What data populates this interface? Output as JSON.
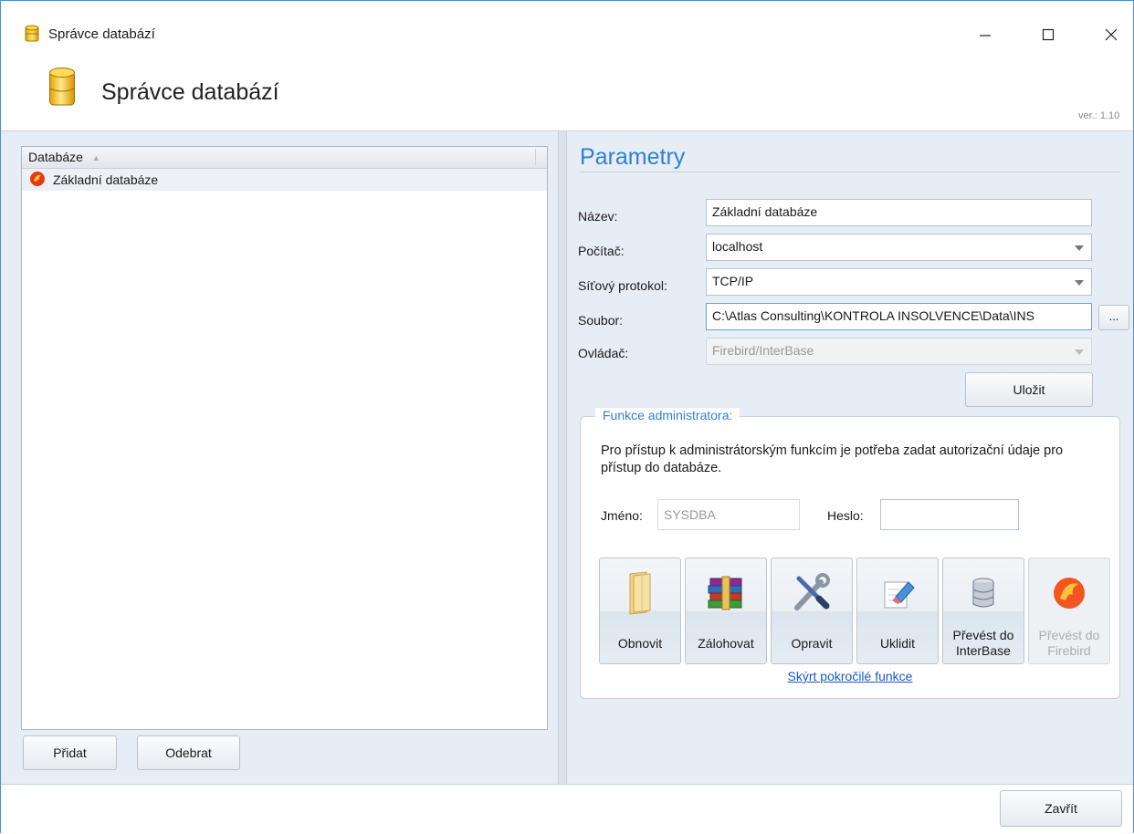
{
  "window": {
    "title": "Správce databází",
    "header_title": "Správce databází",
    "version": "ver.: 1.10"
  },
  "list": {
    "column_header": "Databáze",
    "items": [
      {
        "label": "Základní databáze"
      }
    ]
  },
  "left_buttons": {
    "add": "Přidat",
    "remove": "Odebrat"
  },
  "params": {
    "title": "Parametry",
    "name_label": "Název:",
    "name_value": "Základní databáze",
    "computer_label": "Počítač:",
    "computer_value": "localhost",
    "protocol_label": "Síťový protokol:",
    "protocol_value": "TCP/IP",
    "file_label": "Soubor:",
    "file_value": "C:\\Atlas Consulting\\KONTROLA INSOLVENCE\\Data\\INS",
    "browse_label": "...",
    "driver_label": "Ovládač:",
    "driver_value": "Firebird/InterBase",
    "save_label": "Uložit"
  },
  "admin": {
    "legend": "Funkce administratora:",
    "info": "Pro přístup k administrátorským funkcím je potřeba zadat autorizační údaje pro přístup do databáze.",
    "user_label": "Jméno:",
    "user_value": "SYSDBA",
    "password_label": "Heslo:",
    "password_value": "",
    "tools": [
      {
        "label": "Obnovit",
        "icon": "folder-icon"
      },
      {
        "label": "Zálohovat",
        "icon": "archive-books-icon"
      },
      {
        "label": "Opravit",
        "icon": "tools-icon"
      },
      {
        "label": "Uklidit",
        "icon": "eraser-icon"
      },
      {
        "label": "Převést do InterBase",
        "icon": "database-icon"
      },
      {
        "label": "Převést do Firebird",
        "icon": "firebird-icon",
        "disabled": true
      }
    ],
    "hide_link": "Skýrt pokročilé funkce"
  },
  "footer": {
    "close_label": "Zavřít"
  },
  "colors": {
    "accent": "#2f7fd1",
    "panel_bg": "#e7edf4",
    "link": "#1a57c9"
  }
}
